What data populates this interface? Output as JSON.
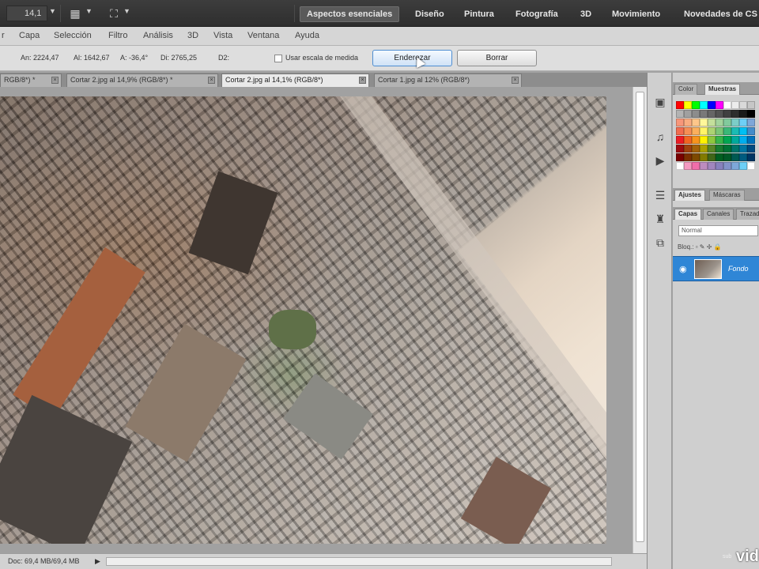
{
  "appbar": {
    "zoom": "14,1",
    "workspaces": [
      {
        "label": "Aspectos esenciales",
        "active": true
      },
      {
        "label": "Diseño"
      },
      {
        "label": "Pintura"
      },
      {
        "label": "Fotografía"
      },
      {
        "label": "3D"
      },
      {
        "label": "Movimiento"
      },
      {
        "label": "Novedades de CS"
      }
    ]
  },
  "menu": [
    "r",
    "Capa",
    "Selección",
    "Filtro",
    "Análisis",
    "3D",
    "Vista",
    "Ventana",
    "Ayuda"
  ],
  "options": {
    "an": "An: 2224,47",
    "al": "Al: 1642,67",
    "a": "A: -36,4°",
    "di": "Di: 2765,25",
    "d2": "D2:",
    "checkbox_label": "Usar escala de medida",
    "straighten_label": "Enderezar",
    "clear_label": "Borrar"
  },
  "tabs": [
    {
      "label": "RGB/8*) *",
      "active": false
    },
    {
      "label": "Cortar 2.jpg al 14,9% (RGB/8*) *",
      "active": false
    },
    {
      "label": "Cortar 2.jpg al 14,1% (RGB/8*)",
      "active": true
    },
    {
      "label": "Cortar 1.jpg al 12% (RGB/8*)",
      "active": false
    }
  ],
  "status": {
    "doc": "Doc: 69,4 MB/69,4 MB"
  },
  "panels": {
    "color_tabs": [
      "Color",
      "Muestras"
    ],
    "adjust_tabs": [
      "Ajustes",
      "Máscaras"
    ],
    "layer_tabs": [
      "Capas",
      "Canales",
      "Trazados"
    ],
    "blend_mode": "Normal",
    "lock_label": "Bloq.:",
    "layer_name": "Fondo"
  },
  "watermark": {
    "text": "vid",
    "small": "sub"
  },
  "colors": {
    "layer_selected": "#2f86d6",
    "workspace_bar": "#333333",
    "menu_bar": "#d6d6d6"
  },
  "swatches": [
    "#ff0000",
    "#ffff00",
    "#00ff00",
    "#00ffff",
    "#0000ff",
    "#ff00ff",
    "#ffffff",
    "#ececec",
    "#d9d9d9",
    "#c6c6c6",
    "#b3b3b3",
    "#a0a0a0",
    "#8c8c8c",
    "#797979",
    "#666666",
    "#535353",
    "#404040",
    "#2d2d2d",
    "#1a1a1a",
    "#000000",
    "#f7977a",
    "#f9ad81",
    "#fdc68a",
    "#fff79a",
    "#c4df9b",
    "#a3d39c",
    "#82ca9d",
    "#7bcdc8",
    "#6ecff6",
    "#7ea7d8",
    "#f26c4f",
    "#f68e55",
    "#fbaf5c",
    "#fff467",
    "#acd372",
    "#7cc576",
    "#3bb878",
    "#1abbb4",
    "#00bff3",
    "#438cca",
    "#ed1c24",
    "#f26522",
    "#f7941d",
    "#fff200",
    "#8dc73f",
    "#39b54a",
    "#00a651",
    "#00a99d",
    "#00aeef",
    "#0072bc",
    "#9e0b0f",
    "#a0410d",
    "#a36209",
    "#aba000",
    "#598527",
    "#197b30",
    "#007236",
    "#00746b",
    "#0076a3",
    "#004a80",
    "#790000",
    "#7b2e00",
    "#7d4900",
    "#827b00",
    "#406618",
    "#005e20",
    "#005826",
    "#005952",
    "#005b7f",
    "#003663",
    "#ffffff",
    "#f49ac1",
    "#f06eaa",
    "#bd8cbf",
    "#a186be",
    "#8781bd",
    "#8393ca",
    "#7da7d9",
    "#6dcff6",
    "#ffffff"
  ]
}
